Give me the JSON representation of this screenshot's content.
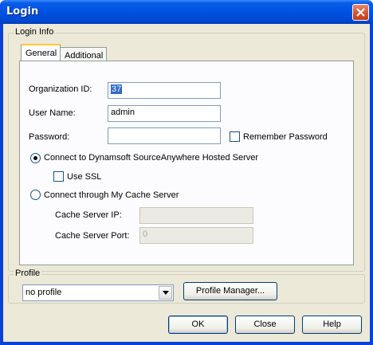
{
  "window": {
    "title": "Login"
  },
  "login_info": {
    "legend": "Login Info",
    "tabs": [
      {
        "label": "General",
        "active": true
      },
      {
        "label": "Additional",
        "active": false
      }
    ],
    "organization_id": {
      "label": "Organization ID:",
      "value": "37"
    },
    "user_name": {
      "label": "User Name:",
      "value": "admin"
    },
    "password": {
      "label": "Password:",
      "value": ""
    },
    "remember_password": {
      "label": "Remember Password",
      "checked": false
    },
    "connect_hosted": {
      "label": "Connect to Dynamsoft SourceAnywhere Hosted Server",
      "checked": true
    },
    "use_ssl": {
      "label": "Use SSL",
      "checked": false
    },
    "connect_cache": {
      "label": "Connect through My Cache Server",
      "checked": false
    },
    "cache_server_ip": {
      "label": "Cache Server IP:",
      "value": ""
    },
    "cache_server_port": {
      "label": "Cache Server Port:",
      "value": "0"
    }
  },
  "profile": {
    "legend": "Profile",
    "selected": "no profile",
    "manager_button": "Profile Manager..."
  },
  "buttons": {
    "ok": "OK",
    "close": "Close",
    "help": "Help"
  },
  "icons": {
    "close": "close-icon",
    "dropdown": "chevron-down-icon"
  }
}
